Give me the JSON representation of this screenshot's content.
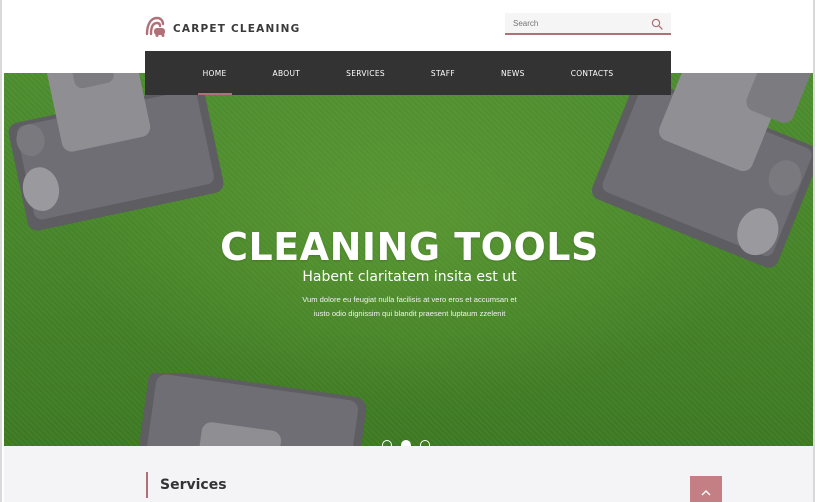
{
  "header": {
    "logo_text": "CARPET CLEANING",
    "search_placeholder": "Search"
  },
  "nav": {
    "items": [
      {
        "label": "HOME",
        "active": true
      },
      {
        "label": "ABOUT"
      },
      {
        "label": "SERVICES"
      },
      {
        "label": "STAFF"
      },
      {
        "label": "NEWS"
      },
      {
        "label": "CONTACTS"
      }
    ]
  },
  "hero": {
    "title": "CLEANING TOOLS",
    "subtitle": "Habent claritatem insita est ut",
    "body_line1": "Vum dolore eu feugiat nulla facilisis at vero eros et accumsan et",
    "body_line2": "iusto odio dignissim qui blandit praesent luptaum zzelenit",
    "slides": 3,
    "active_slide": 2
  },
  "section": {
    "title": "Services"
  },
  "colors": {
    "accent": "#b07078",
    "nav_bg": "#333333",
    "hero_green": "#4a8a2c"
  }
}
